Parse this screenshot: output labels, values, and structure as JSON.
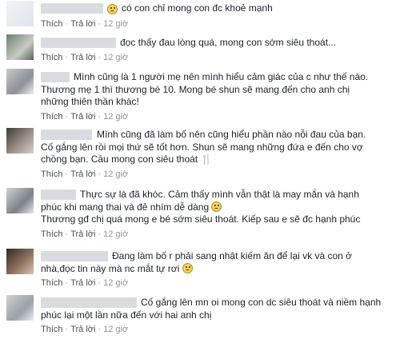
{
  "actions": {
    "like": "Thích",
    "reply": "Trả lời",
    "sep": "·"
  },
  "comments": [
    {
      "lines": [
        "có con chỉ mong con đc khoẻ mạnh"
      ],
      "time": "12 giờ"
    },
    {
      "lines": [
        "đọc thấy đau lòng quá, mong con sớm siêu thoát..."
      ],
      "time": "12 giờ"
    },
    {
      "lines": [
        "Mình cũng là 1 người mẹ nên mình hiểu cảm giác của c như thế nào.",
        "Thương mẹ 1 thì thương bé 10. Mong bé shun sẽ mang đến cho anh chị",
        "những thiên thần khác!"
      ],
      "time": "12 giờ"
    },
    {
      "lines": [
        "Mình cũng đã làm bố nên cũng hiểu phần nào nỗi đau của bạn.",
        "Cố gắng lên rồi mọi thứ sẽ tốt hơn. Shun sẽ mang những đứa e đến cho vợ",
        "chồng bạn. Cầu mong con siêu thoát"
      ],
      "time": "12 giờ"
    },
    {
      "lines": [
        "Thực sự là đã khóc. Cảm thấy mình vẫn thật là may mắn và hạnh",
        "phúc khi mang thai và đẻ nhím dễ dàng",
        "Thương gđ chị quá mong e bé sớm siêu thoát. Kiếp sau e sẽ đc hạnh phúc"
      ],
      "time": "12 giờ"
    },
    {
      "lines": [
        "Đang làm bố r phải sang nhật kiếm ăn để lại vk và con ở",
        "nhà,đọc tin này mà nc mắt tự rơi"
      ],
      "time": "12 giờ"
    },
    {
      "lines": [
        "Cố gắng lên mn oi mong con dc siêu thoát và niềm hạnh",
        "phúc lại một lần nữa đến với hai anh chị"
      ],
      "time": "12 giờ"
    }
  ],
  "icons": {
    "smile": "smile-emoji",
    "fork": "fork-knife-icon"
  }
}
